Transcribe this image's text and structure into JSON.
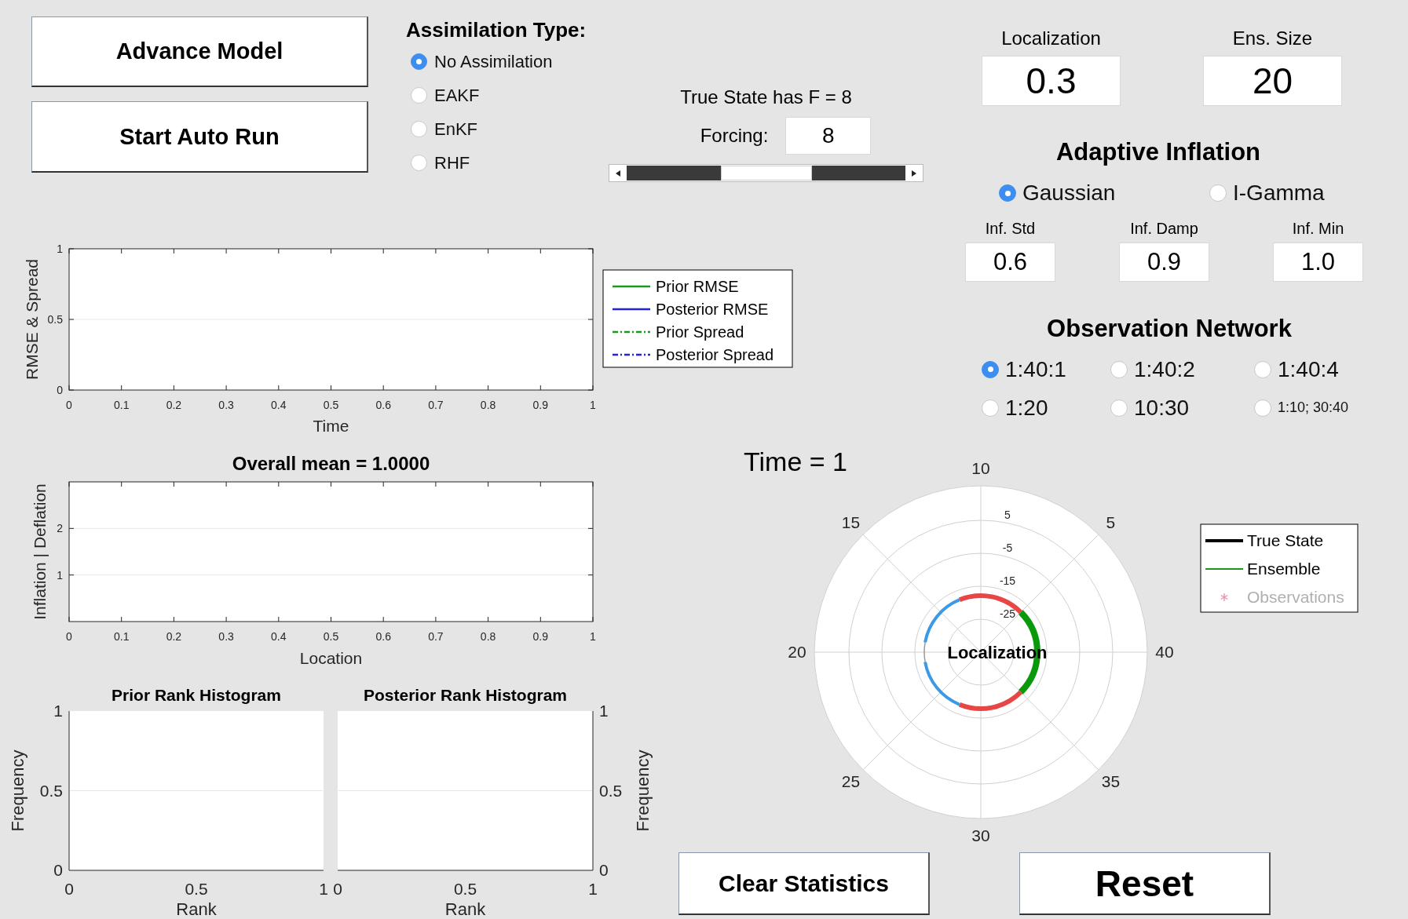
{
  "controls": {
    "buttons": [
      {
        "label": "Advance Model"
      },
      {
        "label": "Start Auto Run"
      }
    ],
    "assimilation": {
      "title": "Assimilation Type:",
      "options": [
        {
          "label": "No Assimilation",
          "selected": true
        },
        {
          "label": "EAKF",
          "selected": false
        },
        {
          "label": "EnKF",
          "selected": false
        },
        {
          "label": "RHF",
          "selected": false
        }
      ]
    },
    "forcing": {
      "true_state": "True State has F = 8",
      "label": "Forcing:",
      "value": "8",
      "slider": {
        "level": 0.5
      }
    }
  },
  "settings": {
    "fields": [
      {
        "label": "Localization",
        "value": "0.3"
      },
      {
        "label": "Ens. Size",
        "value": "20"
      }
    ],
    "adaptive_inflation": {
      "title": "Adaptive Inflation",
      "options": [
        {
          "label": "Gaussian",
          "selected": true
        },
        {
          "label": "I-Gamma",
          "selected": false
        }
      ],
      "fields": [
        {
          "label": "Inf. Std",
          "value": "0.6"
        },
        {
          "label": "Inf. Damp",
          "value": "0.9"
        },
        {
          "label": "Inf. Min",
          "value": "1.0"
        }
      ]
    },
    "observation_network": {
      "title": "Observation Network",
      "options": [
        {
          "label": "1:40:1",
          "selected": true
        },
        {
          "label": "1:40:2",
          "selected": false
        },
        {
          "label": "1:40:4",
          "selected": false
        },
        {
          "label": "1:20",
          "selected": false
        },
        {
          "label": "10:30",
          "selected": false
        },
        {
          "label": "1:10; 30:40",
          "selected": false
        }
      ]
    }
  },
  "rmse_plot": {
    "chart_data": {
      "type": "line",
      "xlabel": "Time",
      "ylabel": "RMSE & Spread",
      "xlim": [
        0,
        1
      ],
      "ylim": [
        0,
        1
      ],
      "xticks": [
        0,
        0.1,
        0.2,
        0.3,
        0.4,
        0.5,
        0.6,
        0.7,
        0.8,
        0.9,
        1
      ],
      "yticks": [
        0,
        0.5,
        1
      ]
    },
    "legend": [
      {
        "label": "Prior RMSE",
        "color": "#1a9a1a",
        "kind": "solid"
      },
      {
        "label": "Posterior RMSE",
        "color": "#2323dd",
        "kind": "solid"
      },
      {
        "label": "Prior Spread",
        "color": "#1a9a1a",
        "kind": "dashdot"
      },
      {
        "label": "Posterior Spread",
        "color": "#2323dd",
        "kind": "dashdot"
      }
    ]
  },
  "inflation_plot": {
    "chart_data": {
      "type": "line",
      "title": "Overall mean = 1.0000",
      "xlabel": "Location",
      "ylabel": "Inflation | Deflation",
      "xlim": [
        0,
        1
      ],
      "ylim": [
        0,
        3
      ],
      "xticks": [
        0,
        0.1,
        0.2,
        0.3,
        0.4,
        0.5,
        0.6,
        0.7,
        0.8,
        0.9,
        1
      ],
      "yticks": [
        1,
        2
      ]
    }
  },
  "rank_histograms": [
    {
      "chart_data": {
        "type": "bar",
        "title": "Prior Rank Histogram",
        "xlabel": "Rank",
        "ylabel": "Frequency",
        "xlim": [
          0,
          1
        ],
        "ylim": [
          0,
          1
        ],
        "xticks": [
          0,
          0.5,
          1
        ],
        "yticks": [
          0,
          0.5,
          1
        ]
      }
    },
    {
      "chart_data": {
        "type": "bar",
        "title": "Posterior Rank Histogram",
        "xlabel": "Rank",
        "ylabel": "Frequency",
        "xlim": [
          0,
          1
        ],
        "ylim": [
          0,
          1
        ],
        "xticks": [
          0,
          0.5,
          1
        ],
        "yticks": [
          0,
          0.5,
          1
        ]
      }
    }
  ],
  "state_plot": {
    "time_label": "Time = 1",
    "angle_labels": [
      "10",
      "5",
      "40",
      "35",
      "30",
      "25",
      "20",
      "15"
    ],
    "radial_labels": [
      "5",
      "-5",
      "-15",
      "-25"
    ],
    "center_label": "Localization",
    "legend": [
      {
        "label": "True State",
        "color": "#000000",
        "kind": "thick",
        "disabled": false
      },
      {
        "label": "Ensemble",
        "color": "#1a9a1a",
        "kind": "thin",
        "disabled": false
      },
      {
        "label": "Observations",
        "color": "#e58fb0",
        "kind": "star",
        "disabled": true
      }
    ]
  },
  "bottom_buttons": [
    {
      "label": "Clear Statistics"
    },
    {
      "label": "Reset"
    }
  ]
}
